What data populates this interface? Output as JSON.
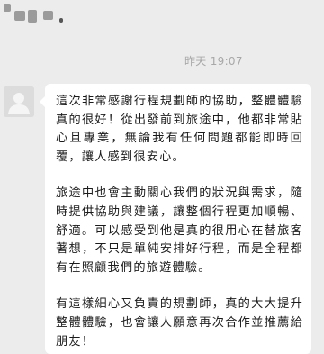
{
  "message": {
    "timestamp": "昨天 19:07",
    "paragraphs": [
      "這次非常感謝行程規劃師的協助，整體體驗真的很好！從出發前到旅途中，他都非常貼心且專業，無論我有任何問題都能即時回覆，讓人感到很安心。",
      "旅途中也會主動關心我們的狀況與需求，隨時提供協助與建議，讓整個行程更加順暢、舒適。可以感受到他是真的很用心在替旅客著想，不只是單純安排好行程，而是全程都有在照顧我們的旅遊體驗。",
      "有這樣細心又負責的規劃師，真的大大提升整體體驗，也會讓人願意再次合作並推薦給朋友！"
    ]
  },
  "colors": {
    "background": "#ececec",
    "bubble": "#ffffff",
    "text": "#1b1b1b",
    "timestamp": "#a8a8a8"
  },
  "icons": {
    "avatar": "default-user-avatar-icon"
  }
}
